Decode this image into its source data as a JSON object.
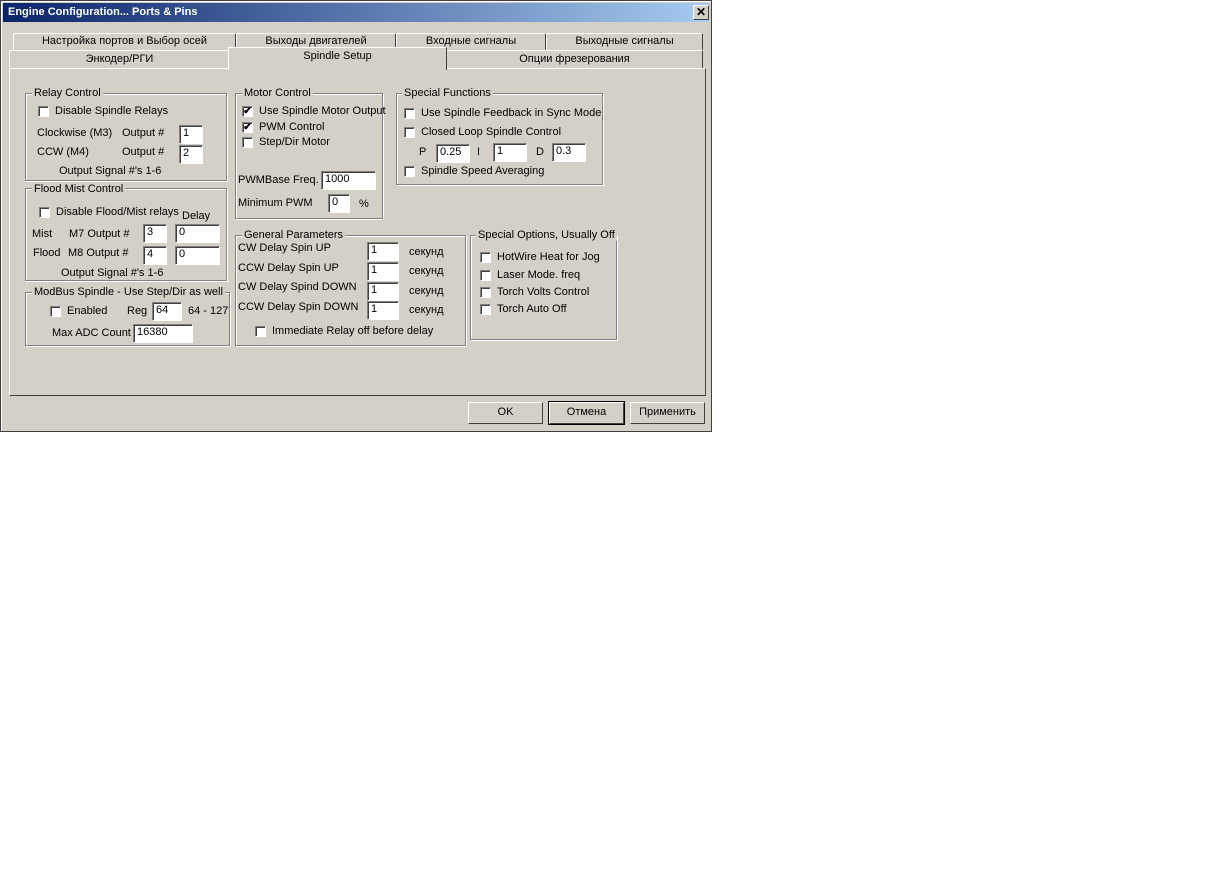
{
  "window": {
    "title": "Engine Configuration... Ports & Pins",
    "close": "✕"
  },
  "tabs_row1": [
    "Настройка портов и Выбор осей",
    "Выходы двигателей",
    "Входные сигналы",
    "Выходные сигналы"
  ],
  "tabs_row2": [
    "Энкодер/РГИ",
    "Spindle Setup",
    "Опции фрезерования"
  ],
  "active_tab": "Spindle Setup",
  "relay": {
    "title": "Relay Control",
    "disable_label": "Disable Spindle Relays",
    "disable_checked": false,
    "cw_label": "Clockwise (M3)",
    "cw_out_label": "Output #",
    "cw_value": "1",
    "ccw_label": "CCW (M4)",
    "ccw_out_label": "Output #",
    "ccw_value": "2",
    "note": "Output Signal #'s 1-6"
  },
  "flood": {
    "title": "Flood Mist Control",
    "disable_label": "Disable Flood/Mist relays",
    "disable_checked": false,
    "delay_label": "Delay",
    "mist_label": "Mist",
    "m7_label": "M7 Output #",
    "m7_value": "3",
    "mist_delay": "0",
    "flood_label": "Flood",
    "m8_label": "M8 Output #",
    "m8_value": "4",
    "flood_delay": "0",
    "note": "Output Signal #'s 1-6"
  },
  "modbus": {
    "title": "ModBus Spindle - Use Step/Dir as well",
    "enabled_label": "Enabled",
    "enabled_checked": false,
    "reg_label": "Reg",
    "reg_value": "64",
    "reg_range": "64 - 127",
    "adc_label": "Max ADC Count",
    "adc_value": "16380"
  },
  "motor": {
    "title": "Motor Control",
    "use_output_label": "Use Spindle Motor Output",
    "use_output_checked": true,
    "pwm_label": "PWM Control",
    "pwm_checked": true,
    "stepdir_label": "Step/Dir Motor",
    "stepdir_checked": false,
    "pwm_freq_label": "PWMBase Freq.",
    "pwm_freq_value": "1000",
    "min_pwm_label": "Minimum PWM",
    "min_pwm_value": "0",
    "min_pwm_unit": "%"
  },
  "special": {
    "title": "Special Functions",
    "feedback_label": "Use Spindle Feedback in Sync Modes",
    "feedback_checked": false,
    "closed_loop_label": "Closed Loop Spindle Control",
    "closed_loop_checked": false,
    "p_label": "P",
    "p_value": "0.25",
    "i_label": "I",
    "i_value": "1",
    "d_label": "D",
    "d_value": "0.3",
    "averaging_label": "Spindle Speed Averaging",
    "averaging_checked": false
  },
  "general": {
    "title": "General Parameters",
    "rows": [
      {
        "label": "CW Delay Spin UP",
        "value": "1",
        "unit": "секунд"
      },
      {
        "label": "CCW Delay Spin UP",
        "value": "1",
        "unit": "секунд"
      },
      {
        "label": "CW Delay Spind DOWN",
        "value": "1",
        "unit": "секунд"
      },
      {
        "label": "CCW Delay Spin DOWN",
        "value": "1",
        "unit": "секунд"
      }
    ],
    "immediate_label": "Immediate Relay off before delay",
    "immediate_checked": false
  },
  "options": {
    "title": "Special Options, Usually Off",
    "items": [
      {
        "label": "HotWire Heat for Jog",
        "checked": false
      },
      {
        "label": "Laser Mode. freq",
        "checked": false
      },
      {
        "label": "Torch Volts Control",
        "checked": false
      },
      {
        "label": "Torch Auto Off",
        "checked": false
      }
    ]
  },
  "buttons": {
    "ok": "OK",
    "cancel": "Отмена",
    "apply": "Применить"
  },
  "colors": {
    "face": "#d4d0c8",
    "title_start": "#0a246a",
    "title_end": "#a6caf0"
  }
}
